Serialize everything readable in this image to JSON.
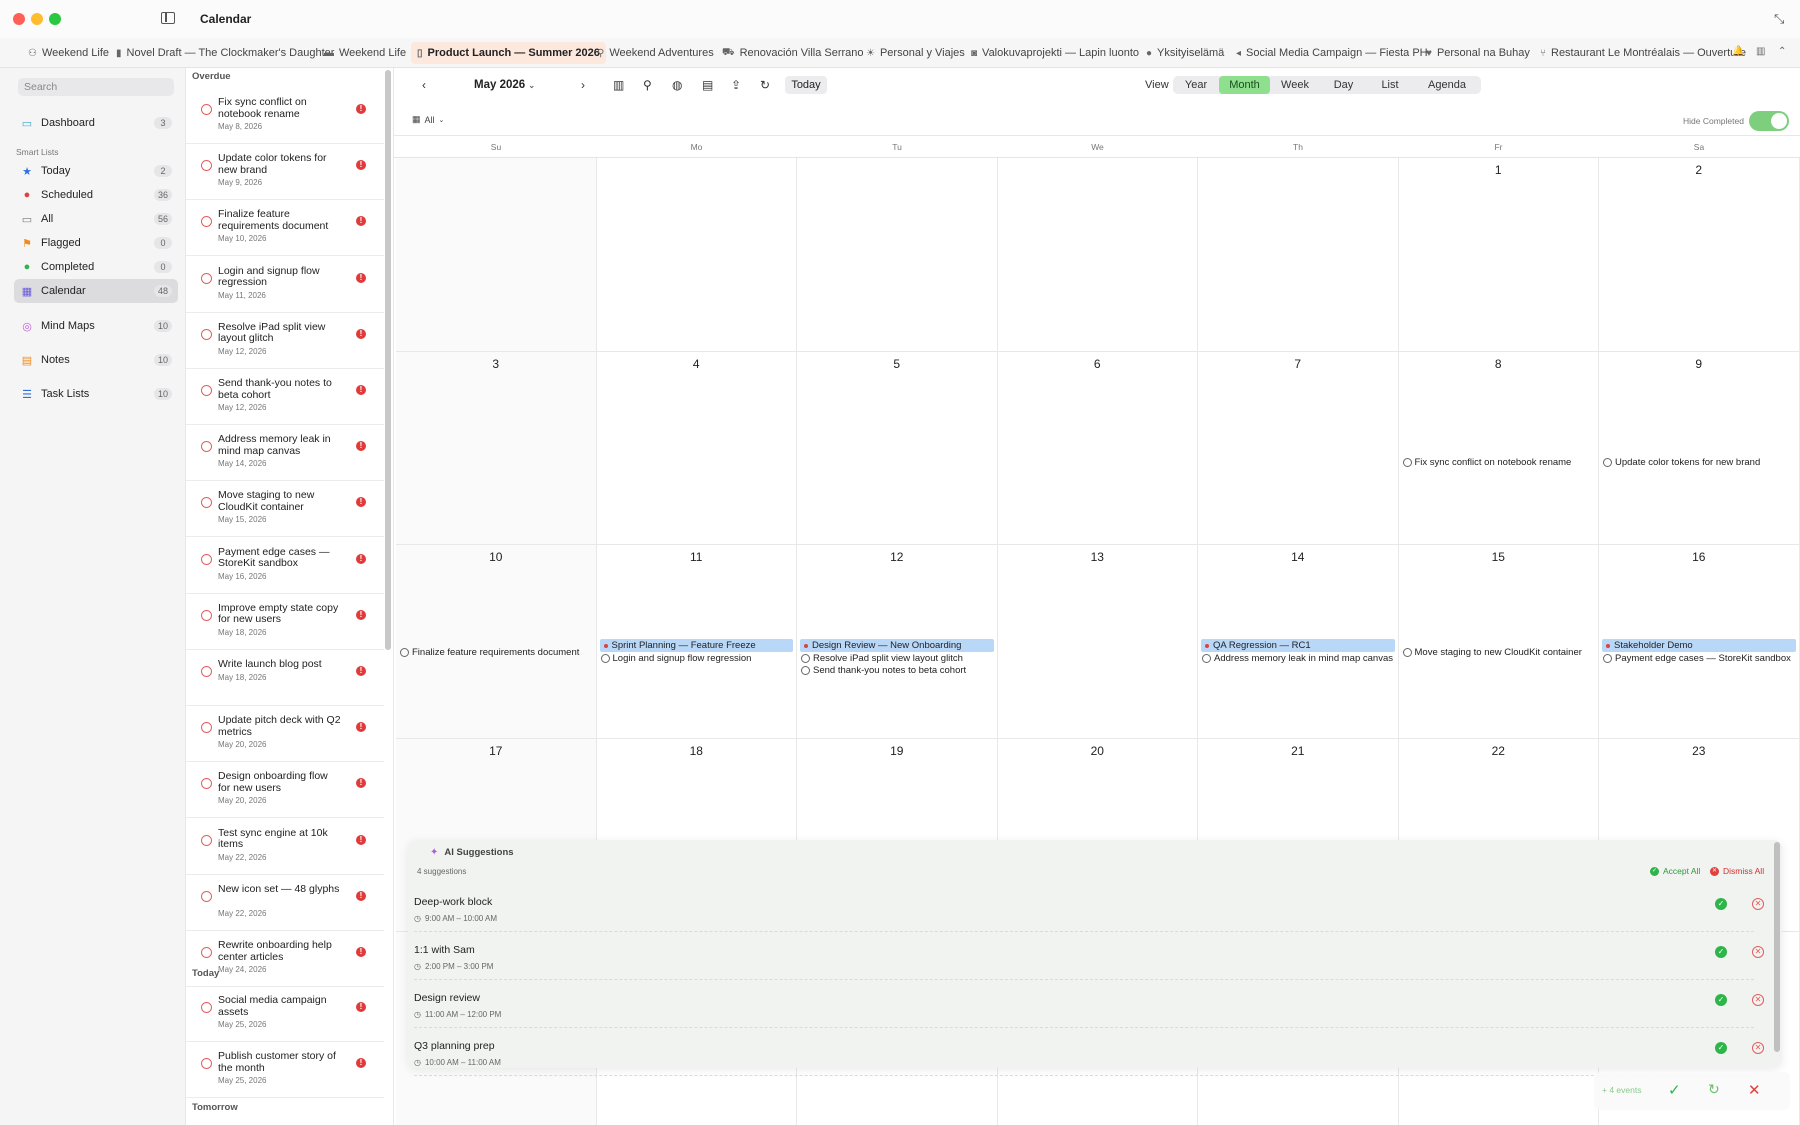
{
  "window": {
    "title": "Calendar"
  },
  "tabs": [
    {
      "icon": "person-icon",
      "label": "Weekend Life"
    },
    {
      "icon": "book-icon",
      "label": "Novel Draft — The Clockmaker's Daughter"
    },
    {
      "icon": "bed-icon",
      "label": "Weekend Life"
    },
    {
      "icon": "doc-icon",
      "label": "Product Launch — Summer 2026",
      "active": true
    },
    {
      "icon": "walk-icon",
      "label": "Weekend Adventures"
    },
    {
      "icon": "car-icon",
      "label": "Renovación Villa Serrano"
    },
    {
      "icon": "sun-icon",
      "label": "Personal y Viajes"
    },
    {
      "icon": "camera-icon",
      "label": "Valokuvaprojekti — Lapin luonto"
    },
    {
      "icon": "circle-icon",
      "label": "Yksityiselämä"
    },
    {
      "icon": "megaphone-icon",
      "label": "Social Media Campaign — Fiesta PH"
    },
    {
      "icon": "heart-icon",
      "label": "Personal na Buhay"
    },
    {
      "icon": "fork-icon",
      "label": "Restaurant Le Montréalais — Ouverture"
    }
  ],
  "sidebar": {
    "search_placeholder": "Search",
    "dashboard": {
      "label": "Dashboard",
      "count": "3"
    },
    "smart_lists_heading": "Smart Lists",
    "smart_lists": [
      {
        "label": "Today",
        "count": "2",
        "color": "#2f6fe0"
      },
      {
        "label": "Scheduled",
        "count": "36",
        "color": "#e04040"
      },
      {
        "label": "All",
        "count": "56",
        "color": "#777777"
      },
      {
        "label": "Flagged",
        "count": "0",
        "color": "#f08a1c"
      },
      {
        "label": "Completed",
        "count": "0",
        "color": "#2fb44a"
      },
      {
        "label": "Calendar",
        "count": "48",
        "color": "#6a5ad8",
        "selected": true
      }
    ],
    "other": [
      {
        "label": "Mind Maps",
        "count": "10"
      },
      {
        "label": "Notes",
        "count": "10"
      },
      {
        "label": "Task Lists",
        "count": "10"
      }
    ]
  },
  "task_panel": {
    "overdue_heading": "Overdue",
    "today_heading": "Today",
    "tomorrow_heading": "Tomorrow",
    "overdue": [
      {
        "title": "Fix sync conflict on notebook rename",
        "date": "May 8, 2026"
      },
      {
        "title": "Update color tokens for new brand",
        "date": "May 9, 2026"
      },
      {
        "title": "Finalize feature requirements document",
        "date": "May 10, 2026"
      },
      {
        "title": "Login and signup flow regression",
        "date": "May 11, 2026"
      },
      {
        "title": "Resolve iPad split view layout glitch",
        "date": "May 12, 2026"
      },
      {
        "title": "Send thank-you notes to beta cohort",
        "date": "May 12, 2026"
      },
      {
        "title": "Address memory leak in mind map canvas",
        "date": "May 14, 2026"
      },
      {
        "title": "Move staging to new CloudKit container",
        "date": "May 15, 2026"
      },
      {
        "title": "Payment edge cases — StoreKit sandbox",
        "date": "May 16, 2026"
      },
      {
        "title": "Improve empty state copy for new users",
        "date": "May 18, 2026"
      },
      {
        "title": "Write launch blog post",
        "date": "May 18, 2026"
      },
      {
        "title": "Update pitch deck with Q2 metrics",
        "date": "May 20, 2026"
      },
      {
        "title": "Design onboarding flow for new users",
        "date": "May 20, 2026"
      },
      {
        "title": "Test sync engine at 10k items",
        "date": "May 22, 2026"
      },
      {
        "title": "New icon set — 48 glyphs",
        "date": "May 22, 2026"
      },
      {
        "title": "Rewrite onboarding help center articles",
        "date": "May 24, 2026"
      }
    ],
    "today": [
      {
        "title": "Social media campaign assets",
        "date": "May 25, 2026"
      },
      {
        "title": "Publish customer story of the month",
        "date": "May 25, 2026"
      }
    ],
    "flag_mark": "!"
  },
  "toolbar": {
    "month_label": "May 2026",
    "today_label": "Today",
    "view_label": "View",
    "views": [
      "Year",
      "Month",
      "Week",
      "Day",
      "List",
      "Agenda"
    ],
    "selected_view": "Month",
    "filter_label": "All",
    "hide_completed_label": "Hide Completed",
    "hide_completed_on": true
  },
  "calendar": {
    "weekdays": [
      "Su",
      "Mo",
      "Tu",
      "We",
      "Th",
      "Fr",
      "Sa"
    ],
    "weeks": [
      [
        {
          "d": ""
        },
        {
          "d": ""
        },
        {
          "d": ""
        },
        {
          "d": ""
        },
        {
          "d": ""
        },
        {
          "d": "1"
        },
        {
          "d": "2"
        }
      ],
      [
        {
          "d": "3"
        },
        {
          "d": "4"
        },
        {
          "d": "5"
        },
        {
          "d": "6"
        },
        {
          "d": "7"
        },
        {
          "d": "8",
          "tasks": [
            "Fix sync conflict on notebook rename"
          ]
        },
        {
          "d": "9",
          "tasks": [
            "Update color tokens for new brand"
          ]
        }
      ],
      [
        {
          "d": "10",
          "tasks": [
            "Finalize feature requirements document"
          ]
        },
        {
          "d": "11",
          "event": "Sprint Planning — Feature Freeze",
          "tasks": [
            "Login and signup flow regression"
          ]
        },
        {
          "d": "12",
          "event": "Design Review — New Onboarding",
          "tasks": [
            "Resolve iPad split view layout glitch",
            "Send thank-you notes to beta cohort"
          ]
        },
        {
          "d": "13"
        },
        {
          "d": "14",
          "event": "QA Regression — RC1",
          "tasks": [
            "Address memory leak in mind map canvas"
          ]
        },
        {
          "d": "15",
          "tasks": [
            "Move staging to new CloudKit container"
          ]
        },
        {
          "d": "16",
          "event": "Stakeholder Demo",
          "tasks": [
            "Payment edge cases — StoreKit sandbox"
          ]
        }
      ],
      [
        {
          "d": "17"
        },
        {
          "d": "18"
        },
        {
          "d": "19"
        },
        {
          "d": "20"
        },
        {
          "d": "21"
        },
        {
          "d": "22"
        },
        {
          "d": "23"
        }
      ]
    ]
  },
  "ai_panel": {
    "title": "AI Suggestions",
    "count_label": "4 suggestions",
    "accept_all": "Accept All",
    "dismiss_all": "Dismiss All",
    "suggestions": [
      {
        "title": "Deep-work block",
        "time": "9:00 AM – 10:00 AM"
      },
      {
        "title": "1:1 with Sam",
        "time": "2:00 PM – 3:00 PM"
      },
      {
        "title": "Design review",
        "time": "11:00 AM – 12:00 PM"
      },
      {
        "title": "Q3 planning prep",
        "time": "10:00 AM – 11:00 AM"
      }
    ]
  },
  "bottom_bar": {
    "events_label": "+ 4 events"
  }
}
